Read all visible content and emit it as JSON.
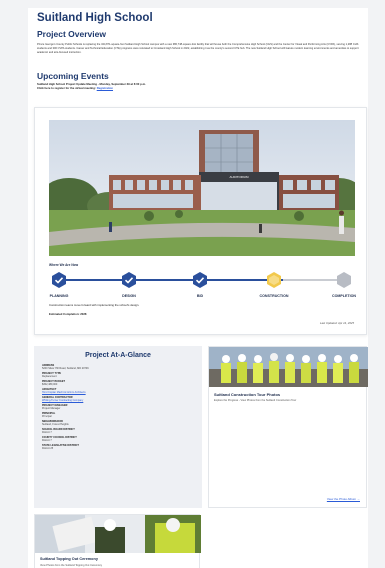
{
  "page": {
    "title": "Suitland High School",
    "overview_heading": "Project Overview",
    "overview_text": "Prince George's County Public Schools is replacing the 344,871-square-foot Suitland High School campus with a new 380,748-square-foot facility that will house both the Comprehensive High School (CHS) and the Center for Visual and Performing Arts (CVPA), serving 1,288 CHS students and 300 CVPA students. Career and Technical Education (CTE) programs were relocated to Crossland High School in 2022, establishing it as the county's second CTE hub. The new Suitland High School will feature modern learning environments and amenities to support academic and arts-focused instruction.",
    "events_heading": "Upcoming Events",
    "event_line": "Suitland High School Project Update Meeting - Monday, September 29 at 6:00 p.m.",
    "event_register_prefix": "Click here to register for the virtual meeting:",
    "event_register_link": "Registration"
  },
  "progress": {
    "heading": "Where We Are Now",
    "phases": [
      {
        "label": "PLANNING",
        "status": "complete"
      },
      {
        "label": "DESIGN",
        "status": "complete"
      },
      {
        "label": "BID",
        "status": "complete"
      },
      {
        "label": "CONSTRUCTION",
        "status": "current"
      },
      {
        "label": "COMPLETION",
        "status": "pending"
      }
    ],
    "status_text": "Construction teams move forward with implementing the school's design.",
    "estimated_completion": "Estimated Completion: 2028",
    "last_updated": "Last Updated: Apr 14, 2025",
    "colors": {
      "complete": "#2a4f9c",
      "current": "#f2c94c",
      "pending": "#b8bcc4"
    }
  },
  "glance": {
    "title": "Project At-A-Glance",
    "items": [
      {
        "label": "ADDRESS",
        "value": "5200 Silver Hill Road, Suitland, MD 20746",
        "link": false
      },
      {
        "label": "PROJECT TYPE",
        "value": "Replacement",
        "link": false
      },
      {
        "label": "PROJECT BUDGET",
        "value": "$302,489,000",
        "link": false
      },
      {
        "label": "ARCHITECT",
        "value": "Hord Coplan Macht & Grimm Architects",
        "link": true
      },
      {
        "label": "GENERAL CONTRACTOR",
        "value": "Whiting-Turner Contracting Company",
        "link": true
      },
      {
        "label": "PROJECT MANAGER",
        "value": "Project Manager",
        "link": false
      },
      {
        "label": "PRINCIPAL",
        "value": "Principal",
        "link": false
      },
      {
        "label": "NEIGHBORHOOD",
        "value": "Suitland, Forest Heights",
        "link": false
      },
      {
        "label": "SCHOOL BOARD DISTRICT",
        "value": "District 7",
        "link": false
      },
      {
        "label": "COUNTY COUNCIL DISTRICT",
        "value": "District 7",
        "link": false
      },
      {
        "label": "STATE LEGISLATIVE DISTRICT",
        "value": "District 25",
        "link": false
      }
    ]
  },
  "photos_card": {
    "title": "Suitland Construction Tour Photos",
    "subtitle": "Explore the Progress - View Photos from the Suitland Construction Tour",
    "link": "View the Photo Album →"
  },
  "topping_card": {
    "title": "Suitland Topping Out Ceremony",
    "subtitle": "View Photos from the Suitland Topping Out Ceremony"
  },
  "theme": {
    "brand": "#1f3a6e",
    "link": "#2a5bd7"
  }
}
